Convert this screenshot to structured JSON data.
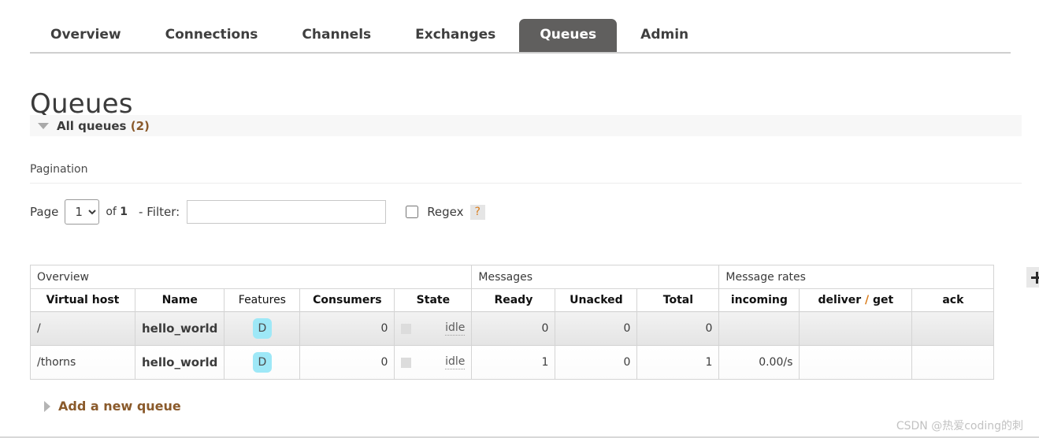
{
  "nav": {
    "tabs": [
      {
        "label": "Overview",
        "active": false
      },
      {
        "label": "Connections",
        "active": false
      },
      {
        "label": "Channels",
        "active": false
      },
      {
        "label": "Exchanges",
        "active": false
      },
      {
        "label": "Queues",
        "active": true
      },
      {
        "label": "Admin",
        "active": false
      }
    ]
  },
  "page": {
    "title": "Queues",
    "all_queues_label": "All queues",
    "all_queues_count": "(2)"
  },
  "pagination": {
    "heading": "Pagination",
    "page_label": "Page",
    "page_value": "1",
    "page_options": [
      "1"
    ],
    "of_prefix": "of",
    "of_total": "1",
    "separator": "-",
    "filter_label": "Filter:",
    "filter_value": "",
    "filter_placeholder": "",
    "regex_label": "Regex",
    "regex_checked": false,
    "help_label": "?"
  },
  "table": {
    "groups": [
      {
        "label": "Overview",
        "span": 5
      },
      {
        "label": "Messages",
        "span": 3
      },
      {
        "label": "Message rates",
        "span": 3
      }
    ],
    "columns": [
      {
        "label": "Virtual host",
        "sortable": true,
        "align": "left"
      },
      {
        "label": "Name",
        "sortable": true,
        "align": "left"
      },
      {
        "label": "Features",
        "sortable": false,
        "align": "left"
      },
      {
        "label": "Consumers",
        "sortable": true,
        "align": "left"
      },
      {
        "label": "State",
        "sortable": true,
        "align": "left"
      },
      {
        "label": "Ready",
        "sortable": true,
        "align": "left"
      },
      {
        "label": "Unacked",
        "sortable": true,
        "align": "left"
      },
      {
        "label": "Total",
        "sortable": true,
        "align": "left"
      },
      {
        "label": "incoming",
        "sortable": true,
        "align": "left"
      },
      {
        "label": "deliver / get",
        "sortable": true,
        "align": "left"
      },
      {
        "label": "ack",
        "sortable": true,
        "align": "left"
      }
    ],
    "rows": [
      {
        "virtual_host": "/",
        "name": "hello_world",
        "features": "D",
        "consumers": "0",
        "state": "idle",
        "ready": "0",
        "unacked": "0",
        "total": "0",
        "incoming": "",
        "deliver_get": "",
        "ack": ""
      },
      {
        "virtual_host": "/thorns",
        "name": "hello_world",
        "features": "D",
        "consumers": "0",
        "state": "idle",
        "ready": "1",
        "unacked": "0",
        "total": "1",
        "incoming": "0.00/s",
        "deliver_get": "",
        "ack": ""
      }
    ],
    "column_toggle": "+"
  },
  "add_queue": {
    "label": "Add a new queue"
  },
  "watermark": {
    "text": "CSDN @热爱coding的刺"
  },
  "colors": {
    "active_tab_bg": "#605f5e",
    "feature_badge_bg": "#9ee8f7",
    "accent_brown": "#8a5a2b",
    "accent_orange": "#d97b19"
  }
}
